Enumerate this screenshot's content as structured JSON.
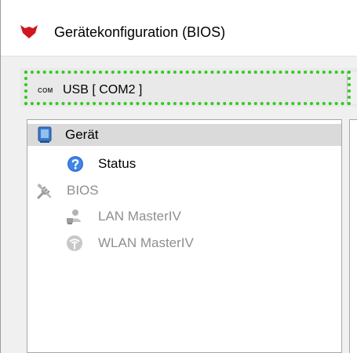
{
  "window": {
    "title": "Gerätekonfiguration (BIOS)"
  },
  "connection": {
    "tag": "COM",
    "label": "USB [ COM2 ]"
  },
  "tree": {
    "items": [
      {
        "label": "Gerät",
        "icon": "device-icon",
        "state": "selected"
      },
      {
        "label": "Status",
        "icon": "help-icon",
        "state": "enabled"
      },
      {
        "label": "BIOS",
        "icon": "tools-icon",
        "state": "disabled"
      },
      {
        "label": "LAN MasterIV",
        "icon": "lan-user-icon",
        "state": "disabled"
      },
      {
        "label": "WLAN MasterIV",
        "icon": "wlan-icon",
        "state": "disabled"
      }
    ]
  },
  "colors": {
    "accent_focus": "#2ecc1a",
    "selection": "#dadada",
    "disabled_text": "#8f8f8f",
    "logo_red": "#d0161e"
  }
}
